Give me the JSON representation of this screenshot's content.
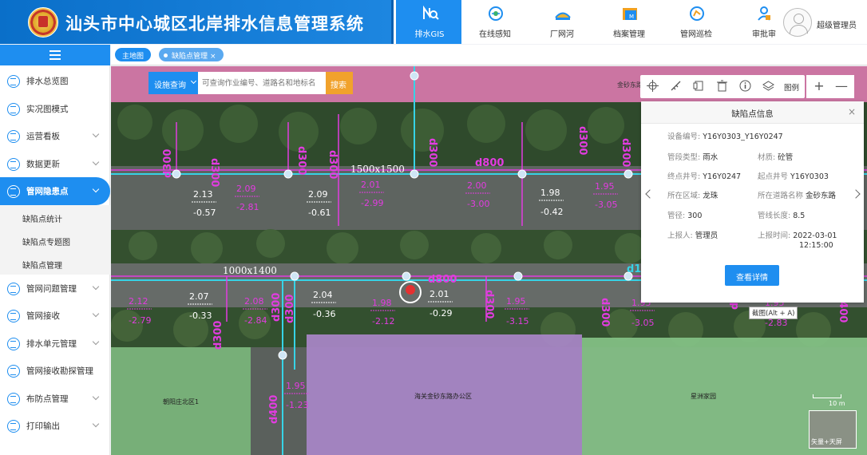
{
  "header": {
    "title": "汕头市中心城区北岸排水信息管理系统",
    "nav": [
      {
        "label": "排水GIS",
        "icon": "gis-search-icon",
        "active": true
      },
      {
        "label": "在线感知",
        "icon": "sensor-icon"
      },
      {
        "label": "厂网河",
        "icon": "factory-icon"
      },
      {
        "label": "档案管理",
        "icon": "archive-icon"
      },
      {
        "label": "管网巡检",
        "icon": "inspection-icon"
      },
      {
        "label": "审批审",
        "icon": "approval-icon"
      }
    ],
    "user": "超级管理员"
  },
  "sidebar": {
    "menu": [
      {
        "label": "排水总览图"
      },
      {
        "label": "实况图模式"
      },
      {
        "label": "运营看板",
        "chevron": true
      },
      {
        "label": "数据更新",
        "chevron": true
      },
      {
        "label": "管网隐患点",
        "chevron": true,
        "active": true
      }
    ],
    "submenu": [
      "缺陷点统计",
      "缺陷点专题图",
      "缺陷点管理"
    ],
    "menu2": [
      {
        "label": "管网问题管理",
        "chevron": true
      },
      {
        "label": "管网接收",
        "chevron": true
      },
      {
        "label": "排水单元管理",
        "chevron": true
      },
      {
        "label": "管网接收勘探管理"
      },
      {
        "label": "布防点管理",
        "chevron": true
      },
      {
        "label": "打印输出",
        "chevron": true
      }
    ]
  },
  "tabs": {
    "home": "主地图",
    "current": "缺陷点管理",
    "close": "×"
  },
  "search": {
    "type": "设施查询",
    "placeholder": "可查询作业编号、道路名和地标名",
    "button": "搜索"
  },
  "toolbar": {
    "legend": "图例",
    "plus": "+",
    "minus": "—"
  },
  "panel": {
    "title": "缺陷点信息",
    "close": "×",
    "fields": {
      "device_no_key": "设备编号:",
      "device_no": "Y16Y0303_Y16Y0247",
      "pipe_type_key": "管段类型:",
      "pipe_type": "雨水",
      "material_key": "材质:",
      "material": "砼管",
      "end_well_key": "终点井号:",
      "end_well": "Y16Y0247",
      "start_well_key": "起点井号",
      "start_well": "Y16Y0303",
      "area_key": "所在区域:",
      "area": "龙珠",
      "road_key": "所在道路名称",
      "road": "金砂东路",
      "diameter_key": "管径:",
      "diameter": "300",
      "length_key": "管线长度:",
      "length": "8.5",
      "reporter_key": "上报人:",
      "reporter": "管理员",
      "time_key": "上报时间:",
      "time": "2022-03-01",
      "time2": "12:15:00"
    },
    "button": "查看详情"
  },
  "tooltip": "截图(Alt + A)",
  "map": {
    "labels": {
      "box_top": "1500x1500",
      "box_mid": "1000x1400",
      "road_top": "金砂东路",
      "area_left": "朝阳庄北区1",
      "area_mid": "海关金砂东路办公区",
      "area_right": "星洲家园",
      "scale": "10 m",
      "minimap": "矢量+天屏"
    },
    "pipe_labels": [
      "d300",
      "d300",
      "d300",
      "d300",
      "d300",
      "d300",
      "d300",
      "d300",
      "d800",
      "d800",
      "d300",
      "d300",
      "d300",
      "d300",
      "d400",
      "d300",
      "d1",
      "d400"
    ],
    "elevations": [
      [
        "2.13",
        "-0.57"
      ],
      [
        "2.09",
        "-2.81"
      ],
      [
        "2.09",
        "-0.61"
      ],
      [
        "2.01",
        "-2.99"
      ],
      [
        "2.00",
        "-3.00"
      ],
      [
        "1.98",
        "-0.42"
      ],
      [
        "1.95",
        "-3.05"
      ],
      [
        "2.12",
        "-2.79"
      ],
      [
        "2.07",
        "-0.33"
      ],
      [
        "2.08",
        "-2.84"
      ],
      [
        "2.04",
        "-0.36"
      ],
      [
        "1.98",
        "-2.12"
      ],
      [
        "2.01",
        "-0.29"
      ],
      [
        "1.95",
        "-3.15"
      ],
      [
        "1.95",
        "-3.05"
      ],
      [
        "1.95",
        "-2.83"
      ],
      [
        "1.95",
        "-1.23"
      ]
    ]
  }
}
